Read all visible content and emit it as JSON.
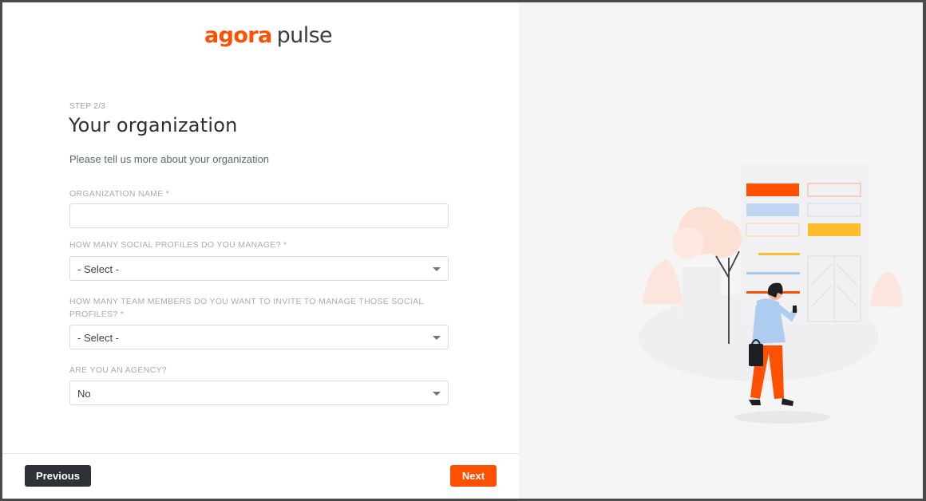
{
  "brand": {
    "logo_part1": "agora",
    "logo_part2": "pulse",
    "accent_color": "#ff4f00"
  },
  "step": {
    "indicator": "STEP 2/3",
    "title": "Your organization",
    "subtitle": "Please tell us more about your organization"
  },
  "form": {
    "org_name": {
      "label": "ORGANIZATION NAME *",
      "value": ""
    },
    "social_profiles": {
      "label": "HOW MANY SOCIAL PROFILES DO YOU MANAGE? *",
      "selected": "- Select -"
    },
    "team_members": {
      "label": "HOW MANY TEAM MEMBERS DO YOU WANT TO INVITE TO MANAGE THOSE SOCIAL PROFILES? *",
      "selected": "- Select -"
    },
    "agency": {
      "label": "ARE YOU AN AGENCY?",
      "selected": "No"
    }
  },
  "footer": {
    "previous_label": "Previous",
    "next_label": "Next"
  },
  "illustration": {
    "icon": "person-walking-with-phone-illustration"
  }
}
